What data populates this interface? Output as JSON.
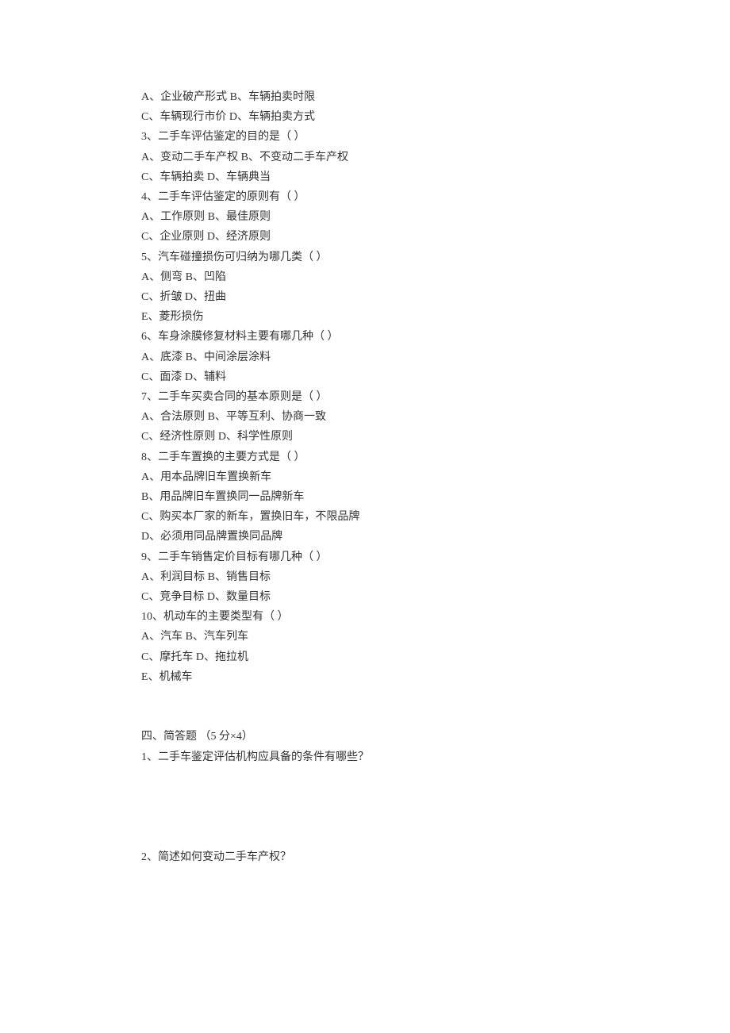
{
  "q2_opt": {
    "ab": "A、企业破产形式 B、车辆拍卖时限",
    "cd": "C、车辆现行市价 D、车辆拍卖方式"
  },
  "q3": {
    "stem": "3、二手车评估鉴定的目的是（ ）",
    "ab": "A、变动二手车产权 B、不变动二手车产权",
    "cd": "C、车辆拍卖 D、车辆典当"
  },
  "q4": {
    "stem": "4、二手车评估鉴定的原则有（ ）",
    "ab": "A、工作原则 B、最佳原则",
    "cd": "C、企业原则 D、经济原则"
  },
  "q5": {
    "stem": "5、汽车碰撞损伤可归纳为哪几类（ ）",
    "ab": "A、侧弯 B、凹陷",
    "cd": "C、折皱 D、扭曲",
    "e": "E、菱形损伤"
  },
  "q6": {
    "stem": "6、车身涂膜修复材料主要有哪几种（ ）",
    "ab": "A、底漆 B、中间涂层涂料",
    "cd": "C、面漆 D、辅料"
  },
  "q7": {
    "stem": "7、二手车买卖合同的基本原则是（ ）",
    "ab": "A、合法原则 B、平等互利、协商一致",
    "cd": "C、经济性原则 D、科学性原则"
  },
  "q8": {
    "stem": "8、二手车置换的主要方式是（ ）",
    "a": "A、用本品牌旧车置换新车",
    "b": "B、用品牌旧车置换同一品牌新车",
    "c": "C、购买本厂家的新车，置换旧车，不限品牌",
    "d": "D、必须用同品牌置换同品牌"
  },
  "q9": {
    "stem": "9、二手车销售定价目标有哪几种（ ）",
    "ab": "A、利润目标 B、销售目标",
    "cd": "C、竞争目标 D、数量目标"
  },
  "q10": {
    "stem": "10、机动车的主要类型有（ ）",
    "ab": "A、汽车 B、汽车列车",
    "cd": "C、摩托车 D、拖拉机",
    "e": "E、机械车"
  },
  "section4": {
    "heading": "四、简答题 （5 分×4）",
    "q1": "1、二手车鉴定评估机构应具备的条件有哪些？",
    "q2": "2、简述如何变动二手车产权？"
  }
}
